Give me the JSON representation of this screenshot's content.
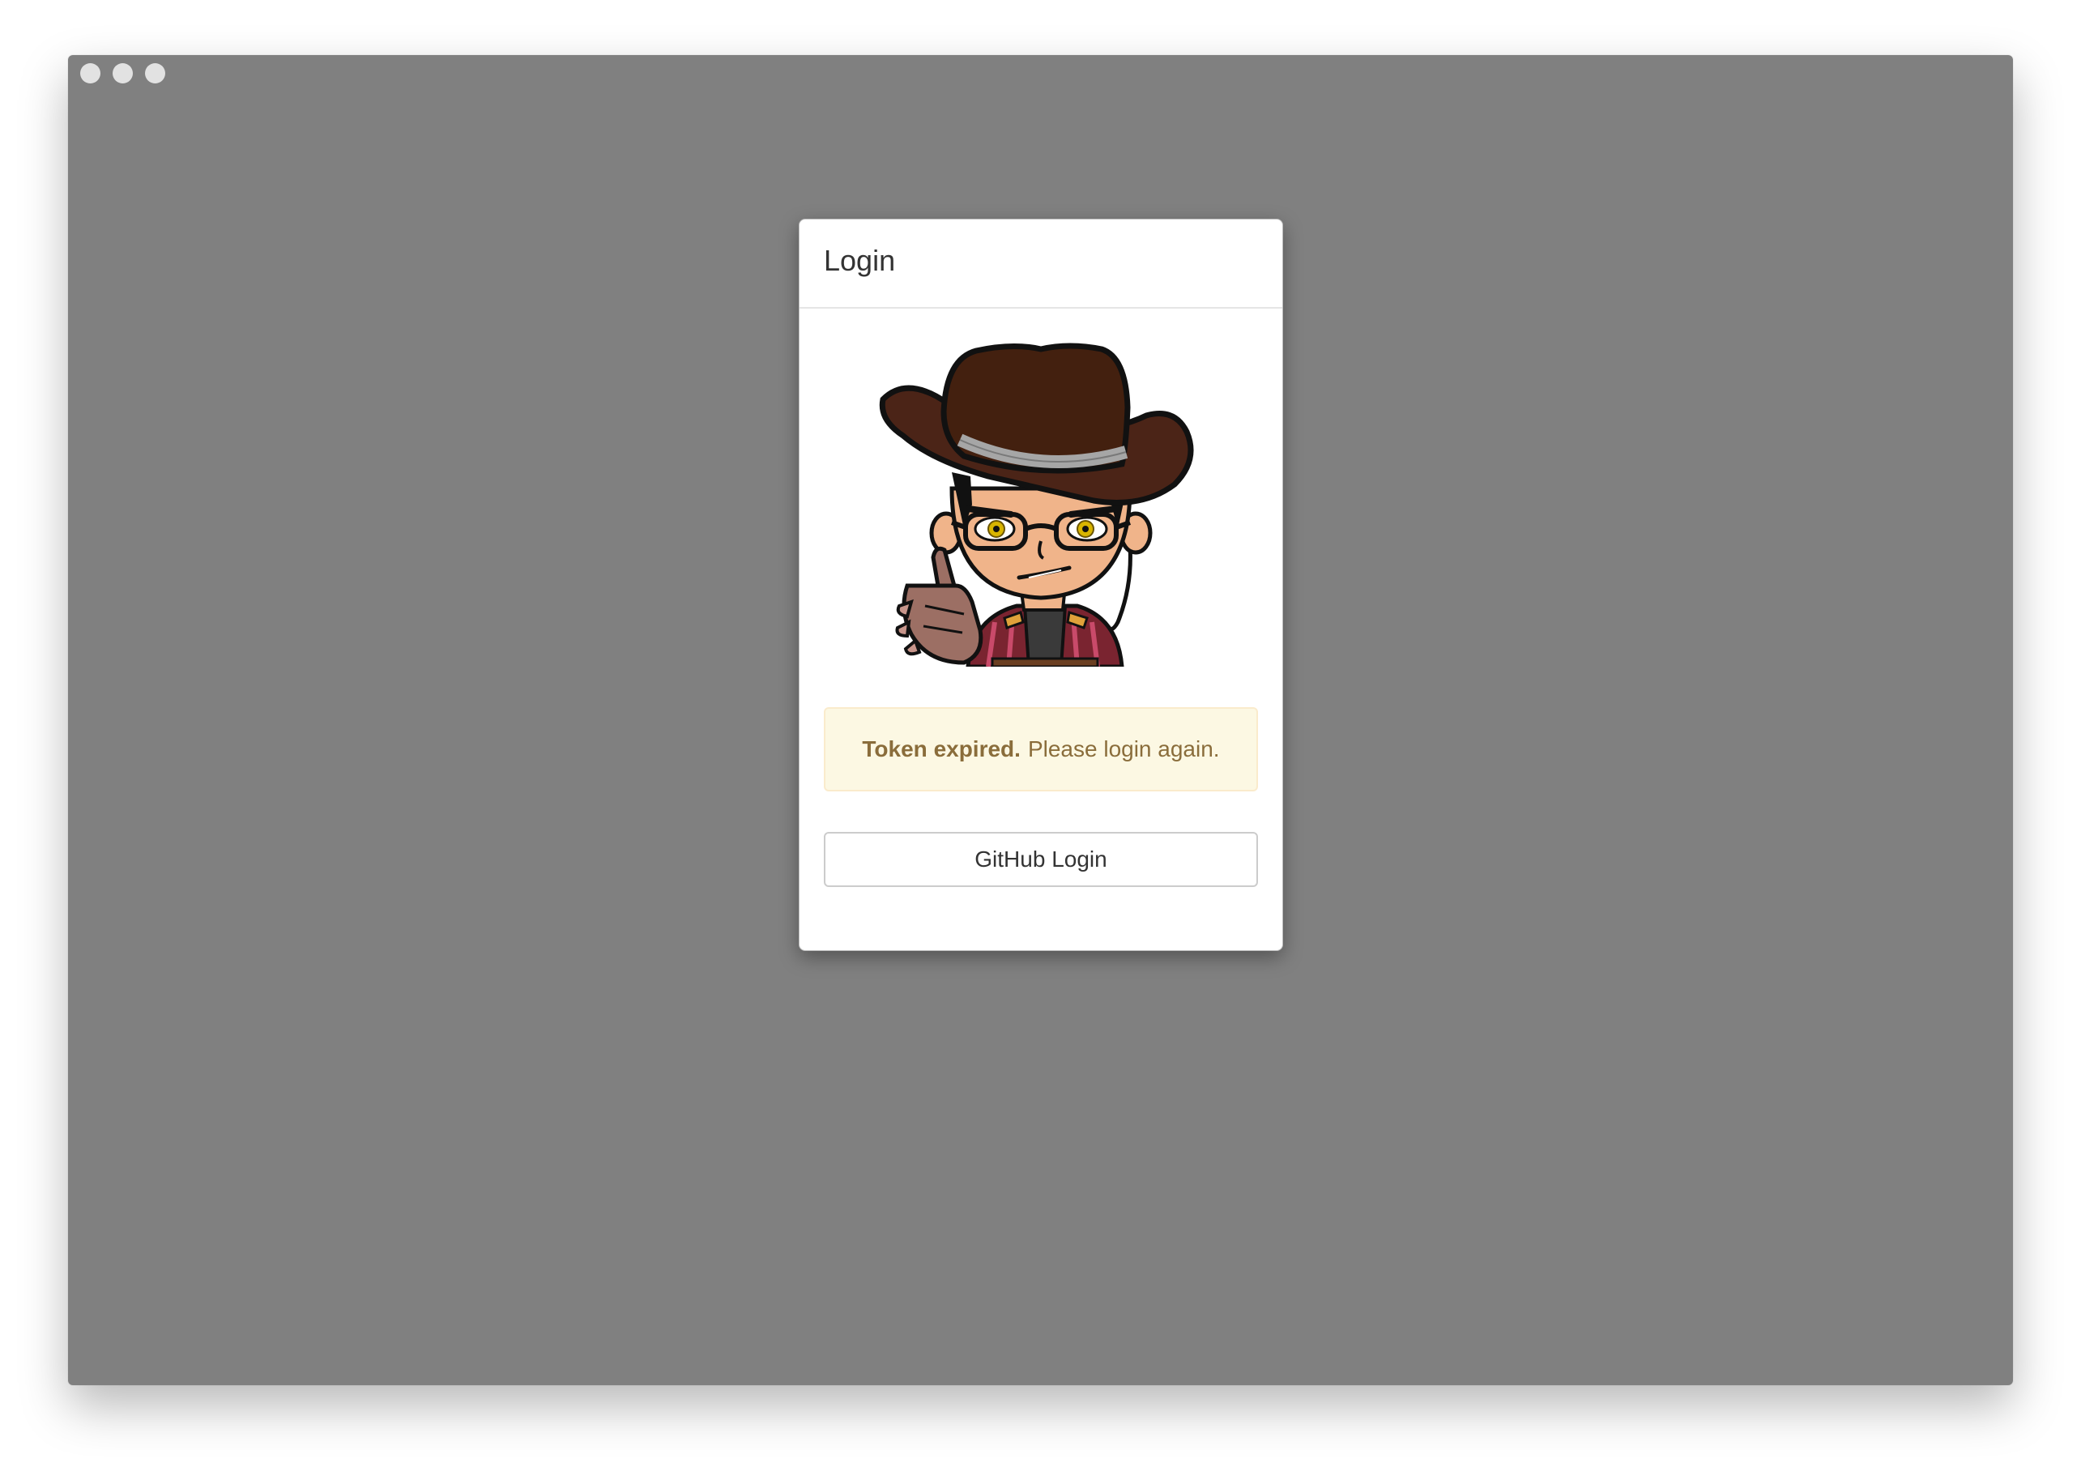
{
  "window": {
    "background_color": "#808080",
    "control_dots": [
      "close",
      "minimize",
      "zoom"
    ]
  },
  "modal": {
    "title": "Login",
    "avatar_icon": "cowboy-avatar",
    "alert": {
      "strong": "Token expired.",
      "text": "Please login again.",
      "background_color": "#fcf8e3",
      "text_color": "#8a6d3b"
    },
    "login_button_label": "GitHub Login"
  }
}
